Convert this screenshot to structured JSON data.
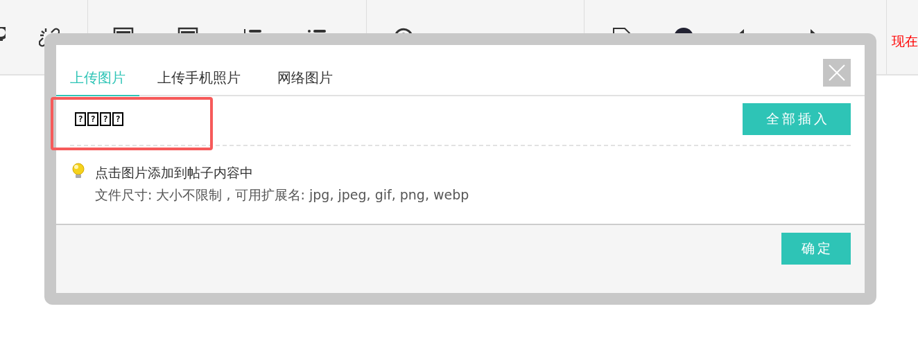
{
  "toolbar": {
    "status_text": "现在"
  },
  "dialog": {
    "tabs": [
      {
        "label": "上传图片",
        "selected": true
      },
      {
        "label": "上传手机照片",
        "selected": false
      },
      {
        "label": "网络图片",
        "selected": false
      }
    ],
    "gallery_label": "????",
    "highlighted": true,
    "insert_all_button": "全部插入",
    "tips": [
      "点击图片添加到帖子内容中",
      "文件尺寸: 大小不限制 , 可用扩展名: jpg, jpeg, gif, png, webp"
    ],
    "confirm_button": "确定"
  }
}
